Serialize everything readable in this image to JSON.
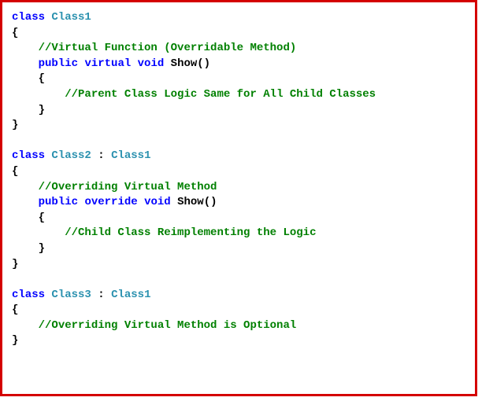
{
  "colors": {
    "border": "#d40000",
    "keyword": "#0000ff",
    "type": "#2b91af",
    "comment": "#008000",
    "text": "#000000"
  },
  "code": {
    "kw_class": "class",
    "kw_public": "public",
    "kw_virtual": "virtual",
    "kw_override": "override",
    "kw_void": "void",
    "class1_name": "Class1",
    "class2_name": "Class2",
    "class3_name": "Class3",
    "base1": "Class1",
    "method_name": "Show",
    "parens": "()",
    "brace_open": "{",
    "brace_close": "}",
    "colon": " : ",
    "comment_virtual_fn": "//Virtual Function (Overridable Method)",
    "comment_parent_logic": "//Parent Class Logic Same for All Child Classes",
    "comment_overriding": "//Overriding Virtual Method",
    "comment_child_logic": "//Child Class Reimplementing the Logic",
    "comment_optional": "//Overriding Virtual Method is Optional"
  }
}
